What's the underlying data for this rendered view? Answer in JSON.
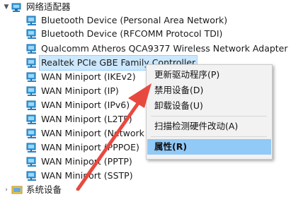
{
  "tree": {
    "category_top": {
      "label": "网络适配器",
      "icon": "network-adapter-folder-icon"
    },
    "devices": [
      {
        "label": "Bluetooth Device (Personal Area Network)",
        "icon": "network-adapter-icon"
      },
      {
        "label": "Bluetooth Device (RFCOMM Protocol TDI)",
        "icon": "network-adapter-icon"
      },
      {
        "label": "Qualcomm Atheros QCA9377 Wireless Network Adapter",
        "icon": "network-adapter-icon"
      },
      {
        "label": "Realtek PCIe GBE Family Controller",
        "icon": "network-adapter-icon",
        "selected": true
      },
      {
        "label": "WAN Miniport (IKEv2)",
        "icon": "network-adapter-icon"
      },
      {
        "label": "WAN Miniport (IP)",
        "icon": "network-adapter-icon"
      },
      {
        "label": "WAN Miniport (IPv6)",
        "icon": "network-adapter-icon"
      },
      {
        "label": "WAN Miniport (L2TP)",
        "icon": "network-adapter-icon"
      },
      {
        "label": "WAN Miniport (Network Monitor)",
        "icon": "network-adapter-icon"
      },
      {
        "label": "WAN Miniport (PPPOE)",
        "icon": "network-adapter-icon"
      },
      {
        "label": "WAN Miniport (PPTP)",
        "icon": "network-adapter-icon"
      },
      {
        "label": "WAN Miniport (SSTP)",
        "icon": "network-adapter-icon"
      }
    ],
    "category_bottom": {
      "label": "系统设备",
      "icon": "system-devices-folder-icon"
    }
  },
  "context_menu": {
    "items": [
      {
        "label": "更新驱动程序(P)"
      },
      {
        "label": "禁用设备(D)"
      },
      {
        "label": "卸载设备(U)"
      },
      {
        "label": "扫描检测硬件改动(A)"
      },
      {
        "label": "属性(R)",
        "bold": true,
        "active": true
      }
    ]
  },
  "colors": {
    "selection_bg": "#cce8ff",
    "menu_bg": "#f2f2f2",
    "menu_hover": "#91c9f7",
    "arrow": "#e8493f"
  }
}
